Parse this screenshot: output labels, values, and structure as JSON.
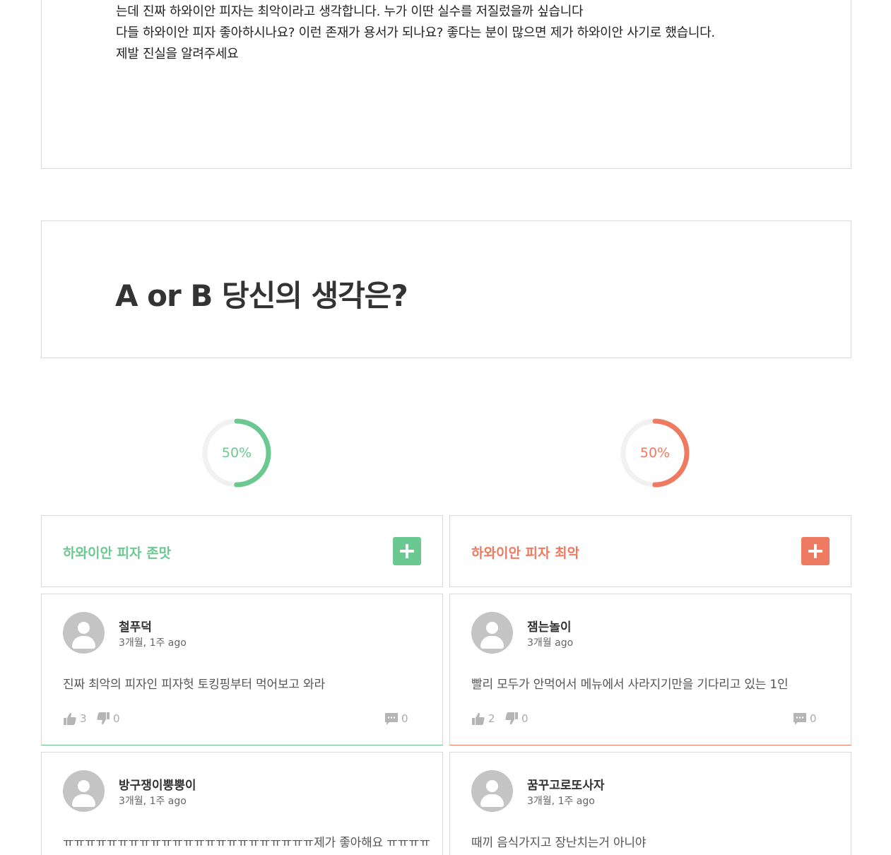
{
  "post": {
    "lines": [
      "는데 진짜 하와이안 피자는 최악이라고 생각합니다. 누가 이딴 실수를 저질렀을까 싶습니다",
      "다들 하와이안 피자 좋아하시나요? 이런 존재가 용서가 되나요? 좋다는 분이 많으면 제가 하와이안 사기로 했습니다.",
      "제발 진실을 알려주세요"
    ]
  },
  "question": {
    "title": "A or B 당신의 생각은?"
  },
  "options": {
    "a": {
      "label": "하와이안 피자 존맛",
      "percent_text": "50%",
      "percent": 50,
      "color": "#6cc891"
    },
    "b": {
      "label": "하와이안 피자 최악",
      "percent_text": "50%",
      "percent": 50,
      "color": "#ee7b61"
    }
  },
  "comments": {
    "a": [
      {
        "author": "철푸덕",
        "time": "3개월, 1주 ago",
        "text": "진짜 최악의 피자인 피자헛 토킹핑부터 먹어보고 와라",
        "likes": "3",
        "dislikes": "0",
        "replies": "0"
      },
      {
        "author": "방구쟁이뿡뿡이",
        "time": "3개월, 1주 ago",
        "text": "ㅠㅠㅠㅠㅠㅠㅠㅠㅠㅠㅠㅠㅠㅠㅠㅠㅠㅠㅠㅠㅠㅠㅠ제가 좋아해요 ㅠㅠㅠㅠ"
      }
    ],
    "b": [
      {
        "author": "잼는놀이",
        "time": "3개월 ago",
        "text": "빨리 모두가 안먹어서 메뉴에서 사라지기만을 기다리고 있는 1인",
        "likes": "2",
        "dislikes": "0",
        "replies": "0"
      },
      {
        "author": "꿈꾸고로또사자",
        "time": "3개월, 1주 ago",
        "text": "때끼 음식가지고 장난치는거 아니야"
      }
    ]
  },
  "icons": {
    "like": "thumbs-up-icon",
    "dislike": "thumbs-down-icon",
    "reply": "comment-bubble-icon",
    "add": "plus-icon",
    "avatar": "user-icon"
  }
}
